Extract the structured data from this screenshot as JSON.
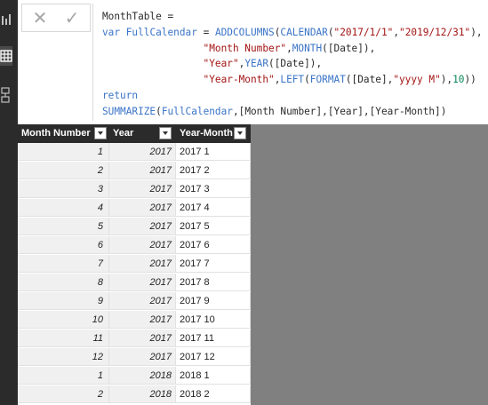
{
  "formula_bar": {
    "cancel_icon": "close-icon",
    "commit_icon": "checkmark-icon",
    "lines": [
      [
        {
          "t": "txt",
          "v": "MonthTable ="
        }
      ],
      [
        {
          "t": "kw",
          "v": "var"
        },
        {
          "t": "txt",
          "v": " "
        },
        {
          "t": "fn",
          "v": "FullCalendar"
        },
        {
          "t": "txt",
          "v": " = "
        },
        {
          "t": "fn",
          "v": "ADDCOLUMNS"
        },
        {
          "t": "txt",
          "v": "("
        },
        {
          "t": "fn",
          "v": "CALENDAR"
        },
        {
          "t": "txt",
          "v": "("
        },
        {
          "t": "str",
          "v": "\"2017/1/1\""
        },
        {
          "t": "txt",
          "v": ","
        },
        {
          "t": "str",
          "v": "\"2019/12/31\""
        },
        {
          "t": "txt",
          "v": "),"
        }
      ],
      [
        {
          "t": "txt",
          "v": "                 "
        },
        {
          "t": "str",
          "v": "\"Month Number\""
        },
        {
          "t": "txt",
          "v": ","
        },
        {
          "t": "fn",
          "v": "MONTH"
        },
        {
          "t": "txt",
          "v": "([Date]),"
        }
      ],
      [
        {
          "t": "txt",
          "v": "                 "
        },
        {
          "t": "str",
          "v": "\"Year\""
        },
        {
          "t": "txt",
          "v": ","
        },
        {
          "t": "fn",
          "v": "YEAR"
        },
        {
          "t": "txt",
          "v": "([Date]),"
        }
      ],
      [
        {
          "t": "txt",
          "v": "                 "
        },
        {
          "t": "str",
          "v": "\"Year-Month\""
        },
        {
          "t": "txt",
          "v": ","
        },
        {
          "t": "fn",
          "v": "LEFT"
        },
        {
          "t": "txt",
          "v": "("
        },
        {
          "t": "fn",
          "v": "FORMAT"
        },
        {
          "t": "txt",
          "v": "([Date],"
        },
        {
          "t": "str",
          "v": "\"yyyy M\""
        },
        {
          "t": "txt",
          "v": "),"
        },
        {
          "t": "num",
          "v": "10"
        },
        {
          "t": "txt",
          "v": "))"
        }
      ],
      [
        {
          "t": "kw",
          "v": "return"
        }
      ],
      [
        {
          "t": "fn",
          "v": "SUMMARIZE"
        },
        {
          "t": "txt",
          "v": "("
        },
        {
          "t": "fn",
          "v": "FullCalendar"
        },
        {
          "t": "txt",
          "v": ",[Month Number],[Year],[Year-Month])"
        }
      ]
    ]
  },
  "table": {
    "columns": [
      "Month Number",
      "Year",
      "Year-Month"
    ],
    "rows": [
      [
        "1",
        "2017",
        "2017 1"
      ],
      [
        "2",
        "2017",
        "2017 2"
      ],
      [
        "3",
        "2017",
        "2017 3"
      ],
      [
        "4",
        "2017",
        "2017 4"
      ],
      [
        "5",
        "2017",
        "2017 5"
      ],
      [
        "6",
        "2017",
        "2017 6"
      ],
      [
        "7",
        "2017",
        "2017 7"
      ],
      [
        "8",
        "2017",
        "2017 8"
      ],
      [
        "9",
        "2017",
        "2017 9"
      ],
      [
        "10",
        "2017",
        "2017 10"
      ],
      [
        "11",
        "2017",
        "2017 11"
      ],
      [
        "12",
        "2017",
        "2017 12"
      ],
      [
        "1",
        "2018",
        "2018 1"
      ],
      [
        "2",
        "2018",
        "2018 2"
      ]
    ]
  },
  "sidebar": {
    "items": [
      {
        "icon": "report-view-icon"
      },
      {
        "icon": "data-view-icon"
      },
      {
        "icon": "model-view-icon"
      }
    ]
  }
}
